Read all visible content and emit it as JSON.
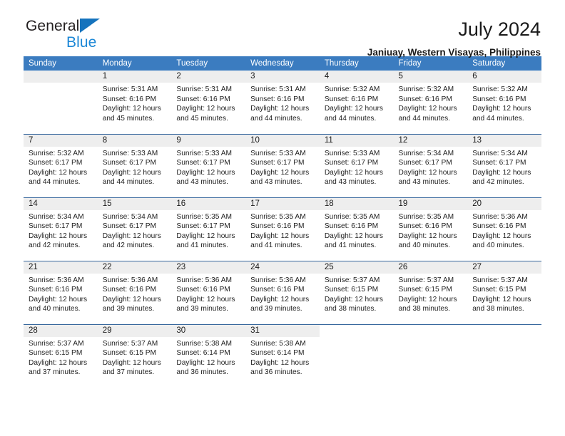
{
  "brand": {
    "name_top": "General",
    "name_bottom": "Blue",
    "triangle_color": "#1573bd",
    "blue_color": "#1b87d6"
  },
  "header": {
    "title": "July 2024",
    "subtitle": "Janiuay, Western Visayas, Philippines"
  },
  "calendar": {
    "header_bg": "#3b7cc0",
    "header_text_color": "#ffffff",
    "daynum_band_bg": "#eeeeee",
    "row_divider_color": "#39699e",
    "weekdays": [
      "Sunday",
      "Monday",
      "Tuesday",
      "Wednesday",
      "Thursday",
      "Friday",
      "Saturday"
    ],
    "weeks": [
      [
        {
          "day": "",
          "sunrise": "",
          "sunset": "",
          "daylight_line1": "",
          "daylight_line2": ""
        },
        {
          "day": "1",
          "sunrise": "Sunrise: 5:31 AM",
          "sunset": "Sunset: 6:16 PM",
          "daylight_line1": "Daylight: 12 hours",
          "daylight_line2": "and 45 minutes."
        },
        {
          "day": "2",
          "sunrise": "Sunrise: 5:31 AM",
          "sunset": "Sunset: 6:16 PM",
          "daylight_line1": "Daylight: 12 hours",
          "daylight_line2": "and 45 minutes."
        },
        {
          "day": "3",
          "sunrise": "Sunrise: 5:31 AM",
          "sunset": "Sunset: 6:16 PM",
          "daylight_line1": "Daylight: 12 hours",
          "daylight_line2": "and 44 minutes."
        },
        {
          "day": "4",
          "sunrise": "Sunrise: 5:32 AM",
          "sunset": "Sunset: 6:16 PM",
          "daylight_line1": "Daylight: 12 hours",
          "daylight_line2": "and 44 minutes."
        },
        {
          "day": "5",
          "sunrise": "Sunrise: 5:32 AM",
          "sunset": "Sunset: 6:16 PM",
          "daylight_line1": "Daylight: 12 hours",
          "daylight_line2": "and 44 minutes."
        },
        {
          "day": "6",
          "sunrise": "Sunrise: 5:32 AM",
          "sunset": "Sunset: 6:16 PM",
          "daylight_line1": "Daylight: 12 hours",
          "daylight_line2": "and 44 minutes."
        }
      ],
      [
        {
          "day": "7",
          "sunrise": "Sunrise: 5:32 AM",
          "sunset": "Sunset: 6:17 PM",
          "daylight_line1": "Daylight: 12 hours",
          "daylight_line2": "and 44 minutes."
        },
        {
          "day": "8",
          "sunrise": "Sunrise: 5:33 AM",
          "sunset": "Sunset: 6:17 PM",
          "daylight_line1": "Daylight: 12 hours",
          "daylight_line2": "and 44 minutes."
        },
        {
          "day": "9",
          "sunrise": "Sunrise: 5:33 AM",
          "sunset": "Sunset: 6:17 PM",
          "daylight_line1": "Daylight: 12 hours",
          "daylight_line2": "and 43 minutes."
        },
        {
          "day": "10",
          "sunrise": "Sunrise: 5:33 AM",
          "sunset": "Sunset: 6:17 PM",
          "daylight_line1": "Daylight: 12 hours",
          "daylight_line2": "and 43 minutes."
        },
        {
          "day": "11",
          "sunrise": "Sunrise: 5:33 AM",
          "sunset": "Sunset: 6:17 PM",
          "daylight_line1": "Daylight: 12 hours",
          "daylight_line2": "and 43 minutes."
        },
        {
          "day": "12",
          "sunrise": "Sunrise: 5:34 AM",
          "sunset": "Sunset: 6:17 PM",
          "daylight_line1": "Daylight: 12 hours",
          "daylight_line2": "and 43 minutes."
        },
        {
          "day": "13",
          "sunrise": "Sunrise: 5:34 AM",
          "sunset": "Sunset: 6:17 PM",
          "daylight_line1": "Daylight: 12 hours",
          "daylight_line2": "and 42 minutes."
        }
      ],
      [
        {
          "day": "14",
          "sunrise": "Sunrise: 5:34 AM",
          "sunset": "Sunset: 6:17 PM",
          "daylight_line1": "Daylight: 12 hours",
          "daylight_line2": "and 42 minutes."
        },
        {
          "day": "15",
          "sunrise": "Sunrise: 5:34 AM",
          "sunset": "Sunset: 6:17 PM",
          "daylight_line1": "Daylight: 12 hours",
          "daylight_line2": "and 42 minutes."
        },
        {
          "day": "16",
          "sunrise": "Sunrise: 5:35 AM",
          "sunset": "Sunset: 6:17 PM",
          "daylight_line1": "Daylight: 12 hours",
          "daylight_line2": "and 41 minutes."
        },
        {
          "day": "17",
          "sunrise": "Sunrise: 5:35 AM",
          "sunset": "Sunset: 6:16 PM",
          "daylight_line1": "Daylight: 12 hours",
          "daylight_line2": "and 41 minutes."
        },
        {
          "day": "18",
          "sunrise": "Sunrise: 5:35 AM",
          "sunset": "Sunset: 6:16 PM",
          "daylight_line1": "Daylight: 12 hours",
          "daylight_line2": "and 41 minutes."
        },
        {
          "day": "19",
          "sunrise": "Sunrise: 5:35 AM",
          "sunset": "Sunset: 6:16 PM",
          "daylight_line1": "Daylight: 12 hours",
          "daylight_line2": "and 40 minutes."
        },
        {
          "day": "20",
          "sunrise": "Sunrise: 5:36 AM",
          "sunset": "Sunset: 6:16 PM",
          "daylight_line1": "Daylight: 12 hours",
          "daylight_line2": "and 40 minutes."
        }
      ],
      [
        {
          "day": "21",
          "sunrise": "Sunrise: 5:36 AM",
          "sunset": "Sunset: 6:16 PM",
          "daylight_line1": "Daylight: 12 hours",
          "daylight_line2": "and 40 minutes."
        },
        {
          "day": "22",
          "sunrise": "Sunrise: 5:36 AM",
          "sunset": "Sunset: 6:16 PM",
          "daylight_line1": "Daylight: 12 hours",
          "daylight_line2": "and 39 minutes."
        },
        {
          "day": "23",
          "sunrise": "Sunrise: 5:36 AM",
          "sunset": "Sunset: 6:16 PM",
          "daylight_line1": "Daylight: 12 hours",
          "daylight_line2": "and 39 minutes."
        },
        {
          "day": "24",
          "sunrise": "Sunrise: 5:36 AM",
          "sunset": "Sunset: 6:16 PM",
          "daylight_line1": "Daylight: 12 hours",
          "daylight_line2": "and 39 minutes."
        },
        {
          "day": "25",
          "sunrise": "Sunrise: 5:37 AM",
          "sunset": "Sunset: 6:15 PM",
          "daylight_line1": "Daylight: 12 hours",
          "daylight_line2": "and 38 minutes."
        },
        {
          "day": "26",
          "sunrise": "Sunrise: 5:37 AM",
          "sunset": "Sunset: 6:15 PM",
          "daylight_line1": "Daylight: 12 hours",
          "daylight_line2": "and 38 minutes."
        },
        {
          "day": "27",
          "sunrise": "Sunrise: 5:37 AM",
          "sunset": "Sunset: 6:15 PM",
          "daylight_line1": "Daylight: 12 hours",
          "daylight_line2": "and 38 minutes."
        }
      ],
      [
        {
          "day": "28",
          "sunrise": "Sunrise: 5:37 AM",
          "sunset": "Sunset: 6:15 PM",
          "daylight_line1": "Daylight: 12 hours",
          "daylight_line2": "and 37 minutes."
        },
        {
          "day": "29",
          "sunrise": "Sunrise: 5:37 AM",
          "sunset": "Sunset: 6:15 PM",
          "daylight_line1": "Daylight: 12 hours",
          "daylight_line2": "and 37 minutes."
        },
        {
          "day": "30",
          "sunrise": "Sunrise: 5:38 AM",
          "sunset": "Sunset: 6:14 PM",
          "daylight_line1": "Daylight: 12 hours",
          "daylight_line2": "and 36 minutes."
        },
        {
          "day": "31",
          "sunrise": "Sunrise: 5:38 AM",
          "sunset": "Sunset: 6:14 PM",
          "daylight_line1": "Daylight: 12 hours",
          "daylight_line2": "and 36 minutes."
        },
        {
          "day": "",
          "sunrise": "",
          "sunset": "",
          "daylight_line1": "",
          "daylight_line2": ""
        },
        {
          "day": "",
          "sunrise": "",
          "sunset": "",
          "daylight_line1": "",
          "daylight_line2": ""
        },
        {
          "day": "",
          "sunrise": "",
          "sunset": "",
          "daylight_line1": "",
          "daylight_line2": ""
        }
      ]
    ]
  }
}
